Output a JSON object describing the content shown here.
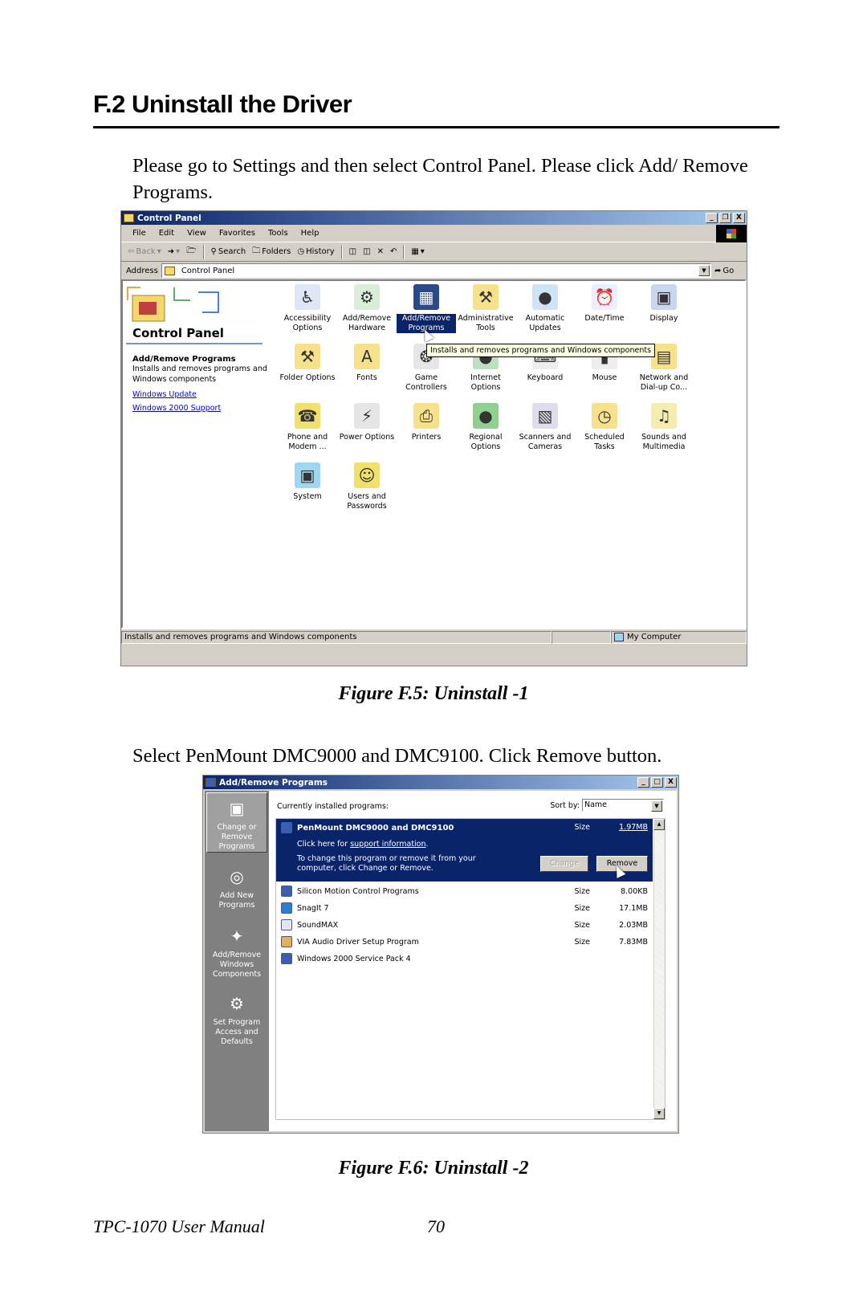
{
  "doc": {
    "heading": "F.2  Uninstall the Driver",
    "intro": "Please go to Settings and then select Control Panel.  Please click Add/ Remove Programs.",
    "figure1_caption": "Figure F.5: Uninstall -1",
    "step2": "Select PenMount DMC9000 and DMC9100.  Click Remove button.",
    "figure2_caption": "Figure F.6: Uninstall -2",
    "footer_title": "TPC-1070 User Manual",
    "page_number": "70"
  },
  "control_panel": {
    "title": "Control Panel",
    "window_buttons": [
      "_",
      "❒",
      "X"
    ],
    "menu": [
      "File",
      "Edit",
      "View",
      "Favorites",
      "Tools",
      "Help"
    ],
    "toolbar": {
      "back": "Back",
      "search": "Search",
      "folders": "Folders",
      "history": "History"
    },
    "address_label": "Address",
    "address_value": "Control Panel",
    "go_label": "Go",
    "pane_title": "Control Panel",
    "pane_heading": "Add/Remove Programs",
    "pane_desc": "Installs and removes programs and Windows components",
    "links": [
      "Windows Update",
      "Windows 2000 Support"
    ],
    "items": [
      {
        "label": "Accessibility Options",
        "icon": "accessibility-icon",
        "glyph": "♿",
        "color": "#dfe6f5"
      },
      {
        "label": "Add/Remove Hardware",
        "icon": "hardware-icon",
        "glyph": "⚙",
        "color": "#d9eed9"
      },
      {
        "label": "Add/Remove Programs",
        "icon": "programs-icon",
        "glyph": "▦",
        "color": "#2c4a8a",
        "selected": true
      },
      {
        "label": "Administrative Tools",
        "icon": "admin-tools-icon",
        "glyph": "⚒",
        "color": "#f7e28b"
      },
      {
        "label": "Automatic Updates",
        "icon": "updates-icon",
        "glyph": "●",
        "color": "#cfe3f7"
      },
      {
        "label": "Date/Time",
        "icon": "clock-icon",
        "glyph": "⏰",
        "color": "#eef"
      },
      {
        "label": "Display",
        "icon": "display-icon",
        "glyph": "▣",
        "color": "#c9d6f0"
      },
      {
        "label": "Folder Options",
        "icon": "folder-options-icon",
        "glyph": "⚒",
        "color": "#f7e28b"
      },
      {
        "label": "Fonts",
        "icon": "fonts-icon",
        "glyph": "A",
        "color": "#f7e28b"
      },
      {
        "label": "Game Controllers",
        "icon": "joystick-icon",
        "glyph": "❂",
        "color": "#e6e6e6"
      },
      {
        "label": "Internet Options",
        "icon": "globe-icon",
        "glyph": "●",
        "color": "#bfe0bf"
      },
      {
        "label": "Keyboard",
        "icon": "keyboard-icon",
        "glyph": "⌨",
        "color": "#eee"
      },
      {
        "label": "Mouse",
        "icon": "mouse-icon",
        "glyph": "▮",
        "color": "#eee"
      },
      {
        "label": "Network and Dial-up Co...",
        "icon": "network-icon",
        "glyph": "▤",
        "color": "#f7e28b"
      },
      {
        "label": "Phone and Modem ...",
        "icon": "phone-icon",
        "glyph": "☎",
        "color": "#f1e06a"
      },
      {
        "label": "Power Options",
        "icon": "power-icon",
        "glyph": "⚡",
        "color": "#e6e6e6"
      },
      {
        "label": "Printers",
        "icon": "printer-icon",
        "glyph": "⎙",
        "color": "#f7e28b"
      },
      {
        "label": "Regional Options",
        "icon": "globe-icon",
        "glyph": "●",
        "color": "#8fd08f"
      },
      {
        "label": "Scanners and Cameras",
        "icon": "scanner-icon",
        "glyph": "▧",
        "color": "#dde"
      },
      {
        "label": "Scheduled Tasks",
        "icon": "tasks-icon",
        "glyph": "◷",
        "color": "#f7e28b"
      },
      {
        "label": "Sounds and Multimedia",
        "icon": "speaker-icon",
        "glyph": "♫",
        "color": "#f5ecb0"
      },
      {
        "label": "System",
        "icon": "computer-icon",
        "glyph": "▣",
        "color": "#9fd6f0"
      },
      {
        "label": "Users and Passwords",
        "icon": "users-icon",
        "glyph": "☺",
        "color": "#f1e06a"
      }
    ],
    "tooltip": "Installs and removes programs and Windows components",
    "status_text": "Installs and removes programs and Windows components",
    "status_zone": "My Computer"
  },
  "add_remove": {
    "title": "Add/Remove Programs",
    "window_buttons": [
      "_",
      "□",
      "X"
    ],
    "tasks": [
      {
        "label": "Change or Remove Programs",
        "glyph": "▣",
        "active": true
      },
      {
        "label": "Add New Programs",
        "glyph": "◎"
      },
      {
        "label": "Add/Remove Windows Components",
        "glyph": "✦"
      },
      {
        "label": "Set Program Access and Defaults",
        "glyph": "⚙"
      }
    ],
    "list_heading": "Currently installed programs:",
    "sort_label": "Sort by:",
    "sort_value": "Name",
    "selected": {
      "name": "PenMount DMC9000 and DMC9100",
      "size_label": "Size",
      "size_value": "1.97MB",
      "support_prefix": "Click here for",
      "support_link": "support information",
      "support_suffix": ".",
      "change_text": "To change this program or remove it from your computer, click Change or Remove.",
      "change_button": "Change",
      "remove_button": "Remove"
    },
    "programs": [
      {
        "name": "Silicon Motion Control Programs",
        "size_label": "Size",
        "size_value": "8.00KB",
        "color": "#3a5fb0"
      },
      {
        "name": "SnagIt 7",
        "size_label": "Size",
        "size_value": "17.1MB",
        "color": "#2a7fd0"
      },
      {
        "name": "SoundMAX",
        "size_label": "Size",
        "size_value": "2.03MB",
        "color": "#dfe6f5"
      },
      {
        "name": "VIA Audio Driver Setup Program",
        "size_label": "Size",
        "size_value": "7.83MB",
        "color": "#e0b060"
      },
      {
        "name": "Windows 2000 Service Pack 4",
        "size_label": "",
        "size_value": "",
        "color": "#3a5fb0"
      }
    ]
  }
}
